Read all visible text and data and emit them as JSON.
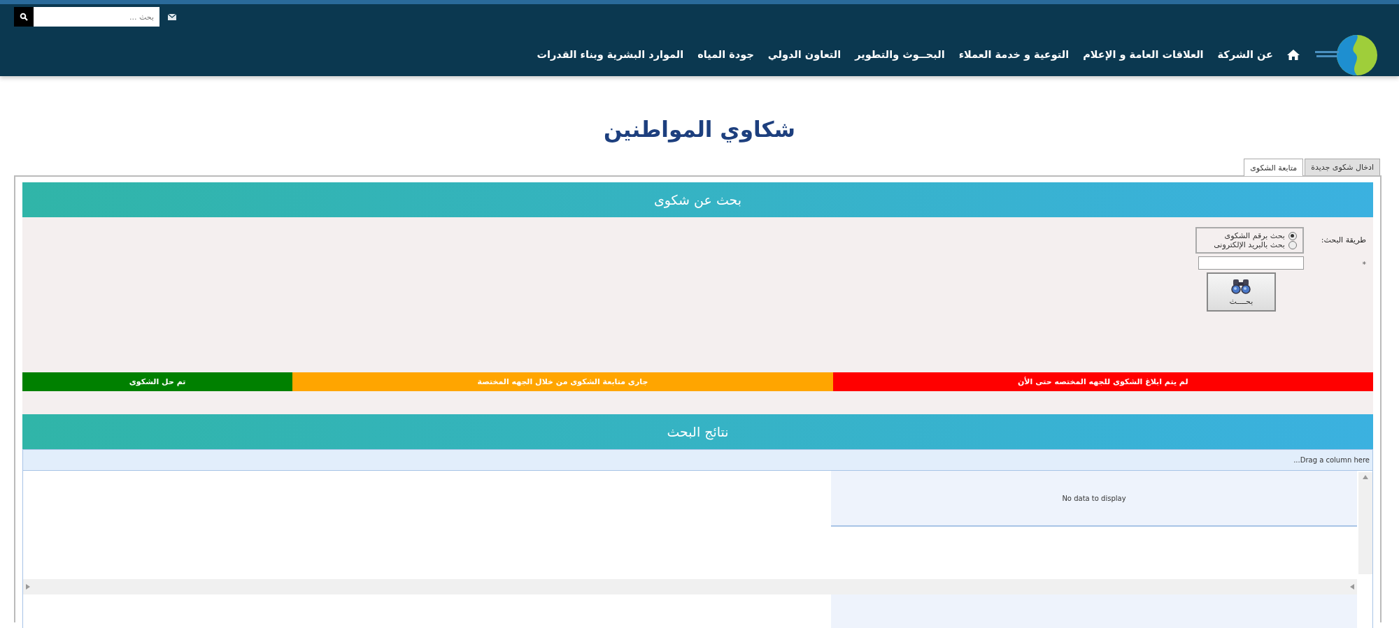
{
  "top_bar": {
    "search": {
      "placeholder": "بحث ..."
    }
  },
  "nav": {
    "items": [
      "عن الشركة",
      "العلاقات العامة و الإعلام",
      "التوعية و خدمة العملاء",
      "البحــوث والتطوير",
      "التعاون الدولي",
      "جودة المياه",
      "الموارد البشرية وبناء القدرات"
    ]
  },
  "page_title": "شكاوي المواطنين",
  "tabs": [
    {
      "label": "ادخال شكوى جديدة",
      "selected": false
    },
    {
      "label": "متابعة الشكوى",
      "selected": true
    }
  ],
  "search_panel": {
    "title": "بحث عن شكوى",
    "method_label": "طريقة البحث:",
    "options": [
      {
        "label": "بحث برقم الشكوى",
        "selected": true
      },
      {
        "label": "بحث بالبريد الإلكترونى",
        "selected": false
      }
    ],
    "required_mark": "*",
    "button": "بحــــث"
  },
  "legend": [
    {
      "label": "لم يتم ابلاغ الشكوى للجهه المختصه حتى الأن",
      "color": "#ff0000"
    },
    {
      "label": "جارى متابعة الشكوى من خلال الجهه المختصة",
      "color": "#ffa500"
    },
    {
      "label": "تم حل الشكوى",
      "color": "#008000"
    }
  ],
  "results": {
    "title": "نتائج البحث",
    "group_panel": "Drag a column here...",
    "empty_text": "No data to display"
  }
}
